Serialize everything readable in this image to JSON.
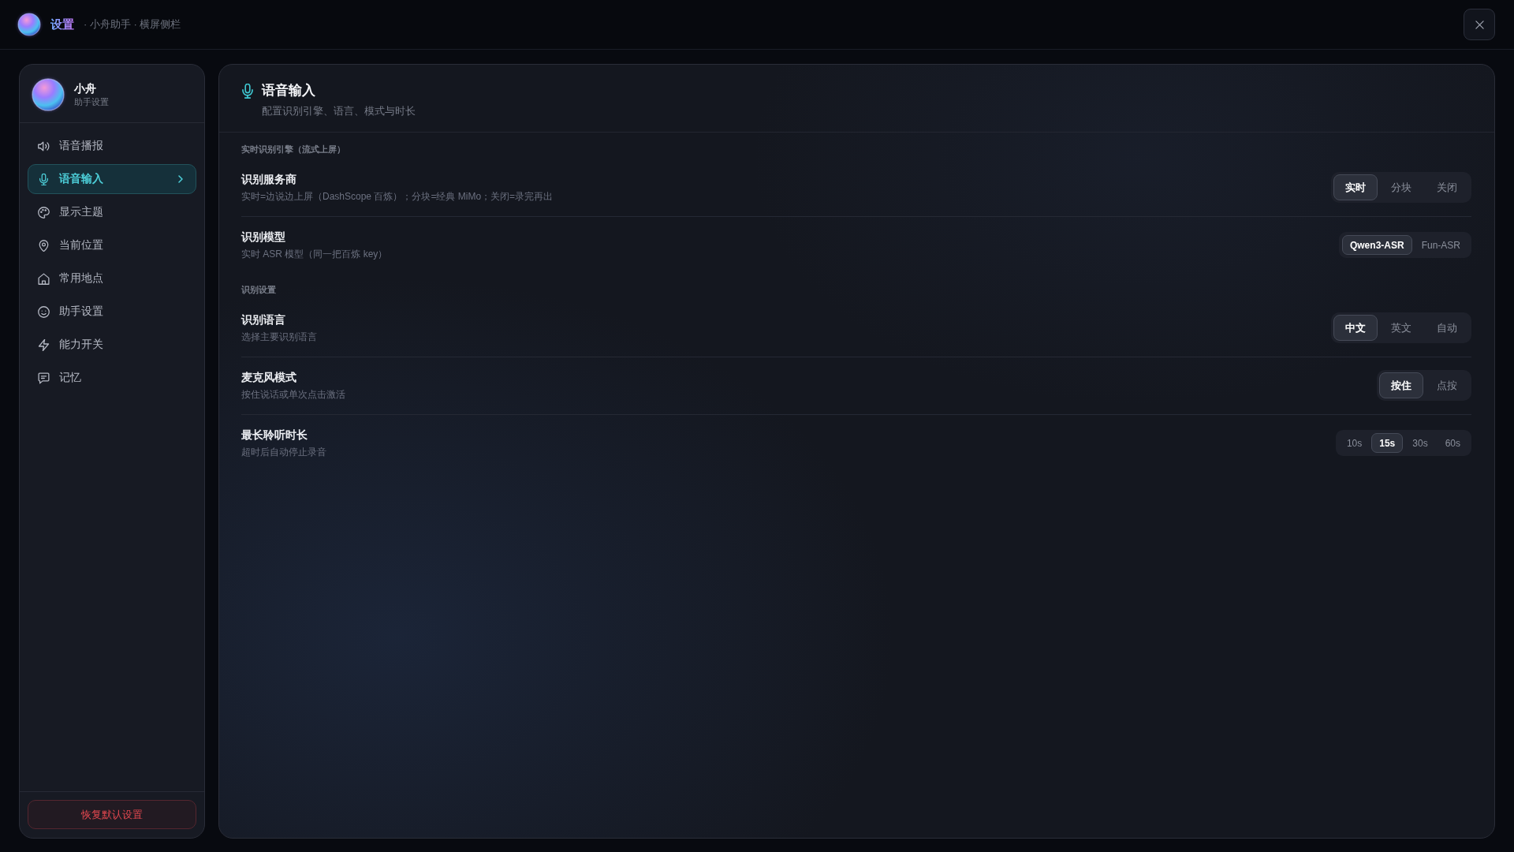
{
  "window": {
    "title": "设置",
    "subtitle": "· 小舟助手 · 横屏侧栏"
  },
  "sidebar": {
    "profile": {
      "name": "小舟",
      "caption": "助手设置"
    },
    "items": [
      {
        "label": "语音播报",
        "selected": false
      },
      {
        "label": "语音输入",
        "selected": true
      },
      {
        "label": "显示主题",
        "selected": false
      },
      {
        "label": "当前位置",
        "selected": false
      },
      {
        "label": "常用地点",
        "selected": false
      },
      {
        "label": "助手设置",
        "selected": false
      },
      {
        "label": "能力开关",
        "selected": false
      },
      {
        "label": "记忆",
        "selected": false
      }
    ],
    "reset_button": "恢复默认设置"
  },
  "panel": {
    "title": "语音输入",
    "subtitle": "配置识别引擎、语言、模式与时长",
    "sections": [
      {
        "label": "实时识别引擎（流式上屏）",
        "rows": [
          {
            "title": "识别服务商",
            "description": "实时=边说边上屏（DashScope 百炼）；分块=经典 MiMo；关闭=录完再出",
            "kind": "segmented",
            "options": [
              {
                "label": "实时",
                "selected": true
              },
              {
                "label": "分块",
                "selected": false
              },
              {
                "label": "关闭",
                "selected": false
              }
            ]
          },
          {
            "title": "识别模型",
            "description": "实时 ASR 模型（同一把百炼 key）",
            "kind": "compact",
            "options": [
              {
                "label": "Qwen3-ASR",
                "selected": true
              },
              {
                "label": "Fun-ASR",
                "selected": false
              }
            ]
          }
        ]
      },
      {
        "label": "识别设置",
        "rows": [
          {
            "title": "识别语言",
            "description": "选择主要识别语言",
            "kind": "segmented",
            "options": [
              {
                "label": "中文",
                "selected": true
              },
              {
                "label": "英文",
                "selected": false
              },
              {
                "label": "自动",
                "selected": false
              }
            ]
          },
          {
            "title": "麦克风模式",
            "description": "按住说话或单次点击激活",
            "kind": "segmented",
            "options": [
              {
                "label": "按住",
                "selected": true
              },
              {
                "label": "点按",
                "selected": false
              }
            ]
          },
          {
            "title": "最长聆听时长",
            "description": "超时后自动停止录音",
            "kind": "compact",
            "options": [
              {
                "label": "10s",
                "selected": false
              },
              {
                "label": "15s",
                "selected": true
              },
              {
                "label": "30s",
                "selected": false
              },
              {
                "label": "60s",
                "selected": false
              }
            ]
          }
        ]
      }
    ]
  }
}
